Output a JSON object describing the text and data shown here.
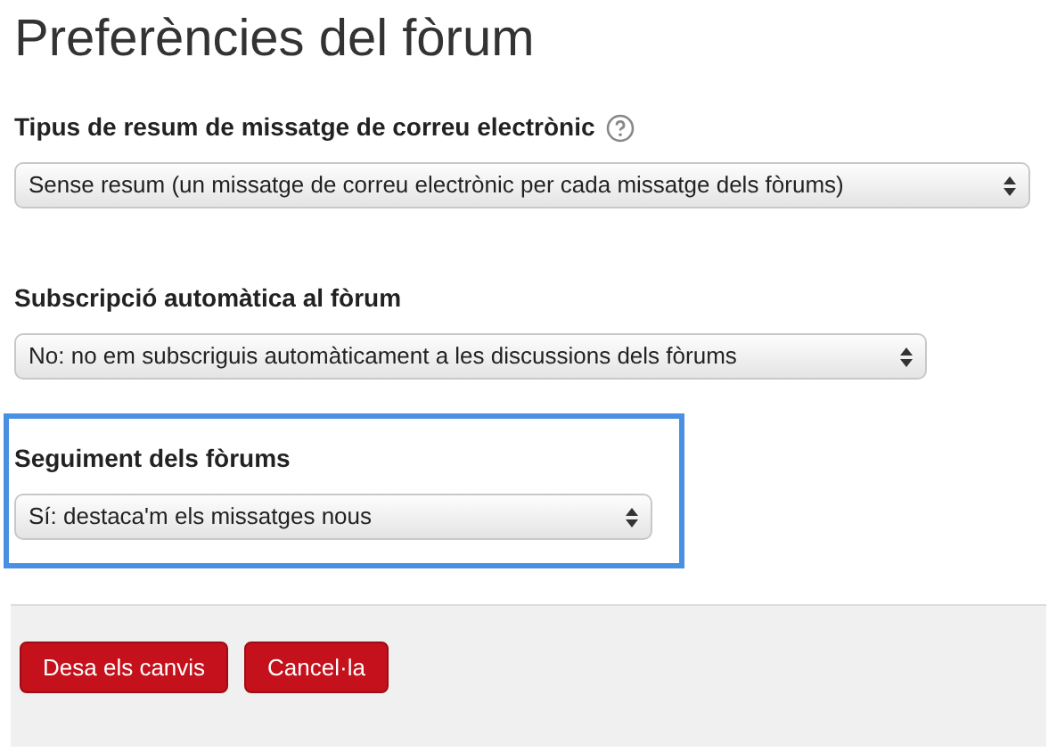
{
  "title": "Preferències del fòrum",
  "fields": [
    {
      "label": "Tipus de resum de missatge de correu electrònic",
      "help": true,
      "value": "Sense resum (un missatge de correu electrònic per cada missatge dels fòrums)",
      "highlighted": false
    },
    {
      "label": "Subscripció automàtica al fòrum",
      "help": false,
      "value": "No: no em subscriguis automàticament a les discussions dels fòrums",
      "highlighted": false
    },
    {
      "label": "Seguiment dels fòrums",
      "help": false,
      "value": "Sí: destaca'm els missatges nous",
      "highlighted": true
    }
  ],
  "buttons": [
    "Desa els canvis",
    "Cancel·la"
  ]
}
